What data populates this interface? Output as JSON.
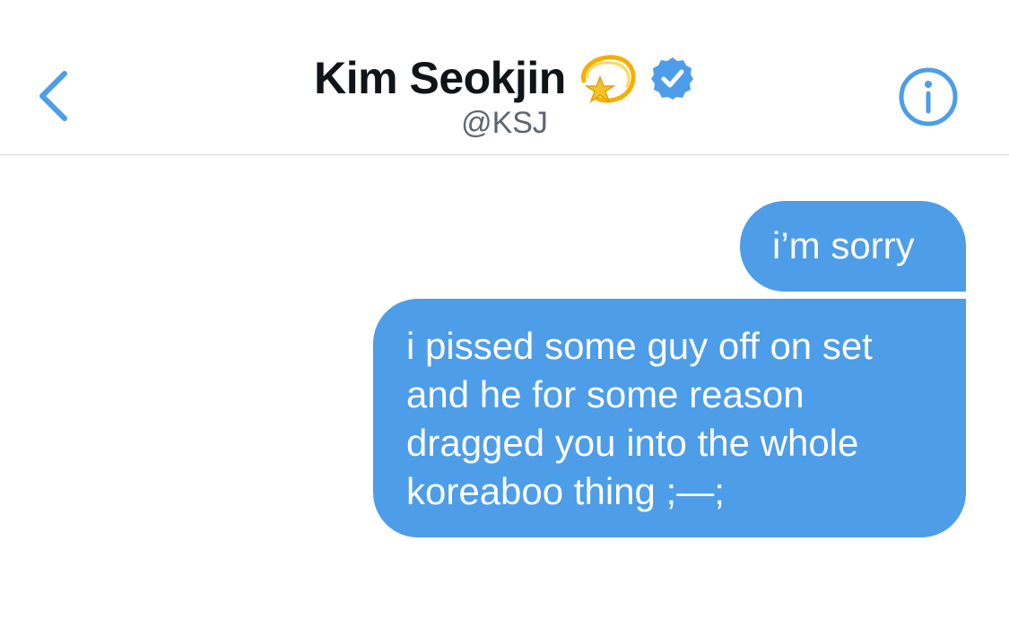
{
  "header": {
    "contact_name": "Kim Seokjin",
    "name_emoji": "dizzy-emoji",
    "verified_badge": "verified-icon",
    "handle": "@KSJ",
    "back_icon": "chevron-left-icon",
    "info_icon": "info-icon"
  },
  "colors": {
    "accent": "#4d9de8",
    "bubble_text": "#ffffff",
    "name_text": "#0f1419",
    "handle_text": "#5b6670",
    "divider": "#d5d8db",
    "emoji_yellow": "#f7c325"
  },
  "messages": [
    {
      "sender": "self",
      "text": "i’m sorry"
    },
    {
      "sender": "self",
      "text": "i pissed some guy off on set\nand he for some reason\ndragged you into the whole\nkoreaboo thing ;—;"
    }
  ]
}
